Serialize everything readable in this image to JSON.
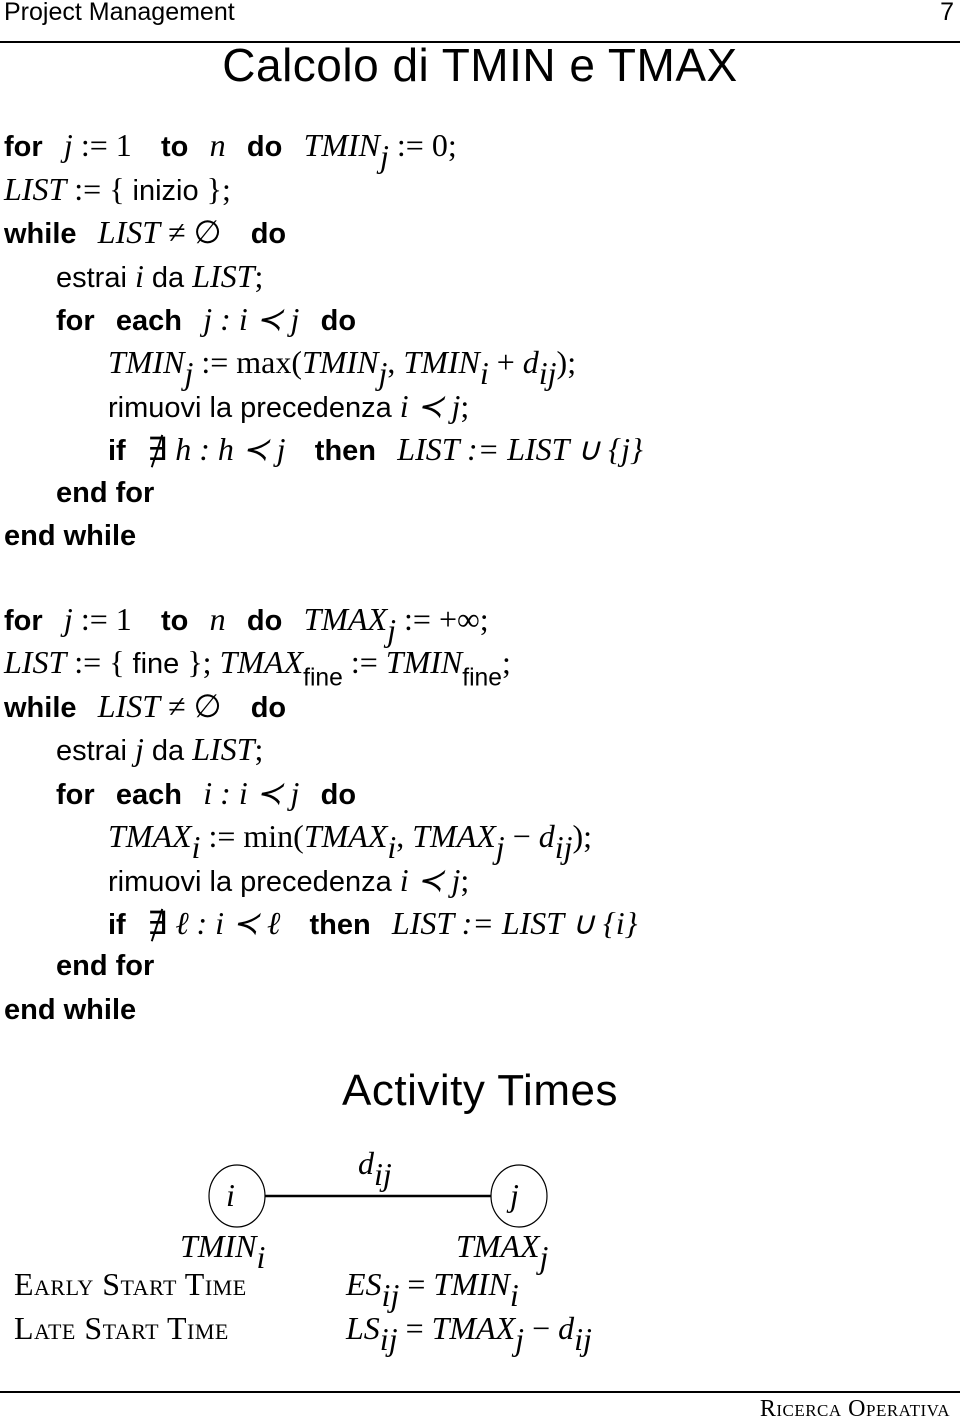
{
  "header": {
    "running_title": "Project Management",
    "page_number": "7"
  },
  "title": "Calcolo di TMIN e TMAX",
  "tmin_algorithm": {
    "l1": {
      "kw_for": "for",
      "j": "j",
      "assign1": " := 1 ",
      "kw_to": "to",
      "n": "n",
      "kw_do": "do",
      "tmin": "TMIN",
      "sub": "j",
      "assign2": " := 0;"
    },
    "l2": {
      "list": "LIST",
      "assign": " := { ",
      "inizio": "inizio",
      "close": " };"
    },
    "l3": {
      "kw_while": "while",
      "list": "LIST",
      "neq": " ≠ ∅ ",
      "kw_do": "do"
    },
    "l4": {
      "estrai": "estrai ",
      "i": "i",
      "da": " da ",
      "list": "LIST",
      "semi": ";"
    },
    "l5": {
      "kw_for": "for",
      "kw_each": "each",
      "cond": "j : i ≺ j",
      "kw_do": "do"
    },
    "l6": {
      "tmin": "TMIN",
      "sub_j": "j",
      "assign": " := ",
      "max": "max",
      "open": "(",
      "tmin2": "TMIN",
      "sub_j2": "j",
      "comma": ", ",
      "tmin3": "TMIN",
      "sub_i": "i",
      "plus": " + ",
      "d": "d",
      "sub_ij": "ij",
      "close": ");"
    },
    "l7": {
      "text": "rimuovi la precedenza ",
      "expr": "i ≺ j",
      "semi": ";"
    },
    "l8": {
      "kw_if": "if",
      "nexists": "∃",
      "cond": " h : h ≺ j ",
      "kw_then": "then",
      "expr": "LIST := LIST ∪ {j}"
    },
    "l9": {
      "kw_endfor": "end for"
    },
    "l10": {
      "kw_endwhile": "end while"
    }
  },
  "tmax_algorithm": {
    "l1": {
      "kw_for": "for",
      "j": "j",
      "assign1": " := 1 ",
      "kw_to": "to",
      "n": "n",
      "kw_do": "do",
      "tmax": "TMAX",
      "sub": "j",
      "assign2": " := +∞;"
    },
    "l2": {
      "list": "LIST",
      "assign": " := { ",
      "fine": "fine",
      "close": " }; ",
      "tmax": "TMAX",
      "sub_fine": "fine",
      "assign2": " := ",
      "tmin": "TMIN",
      "sub_fine2": "fine",
      "semi": ";"
    },
    "l3": {
      "kw_while": "while",
      "list": "LIST",
      "neq": " ≠ ∅ ",
      "kw_do": "do"
    },
    "l4": {
      "estrai": "estrai ",
      "j": "j",
      "da": " da ",
      "list": "LIST",
      "semi": ";"
    },
    "l5": {
      "kw_for": "for",
      "kw_each": "each",
      "cond": "i : i ≺ j",
      "kw_do": "do"
    },
    "l6": {
      "tmax": "TMAX",
      "sub_i": "i",
      "assign": " := ",
      "min": "min",
      "open": "(",
      "tmax2": "TMAX",
      "sub_i2": "i",
      "comma": ", ",
      "tmax3": "TMAX",
      "sub_j": "j",
      "minus": " − ",
      "d": "d",
      "sub_ij": "ij",
      "close": ");"
    },
    "l7": {
      "text": "rimuovi la precedenza ",
      "expr": "i ≺ j",
      "semi": ";"
    },
    "l8": {
      "kw_if": "if",
      "nexists": "∃",
      "cond": " ℓ : i ≺ ℓ ",
      "kw_then": "then",
      "expr": "LIST := LIST ∪ {i}"
    },
    "l9": {
      "kw_endfor": "end for"
    },
    "l10": {
      "kw_endwhile": "end while"
    }
  },
  "activity_times": {
    "title": "Activity Times",
    "diagram": {
      "node_i": "i",
      "node_j": "j",
      "edge_label": "d",
      "edge_sub": "ij",
      "label_i": "TMIN",
      "label_i_sub": "i",
      "label_j": "TMAX",
      "label_j_sub": "j"
    },
    "early": {
      "label": "Early Start Time",
      "lhs": "ES",
      "lhs_sub": "ij",
      "eq": " = ",
      "rhs": "TMIN",
      "rhs_sub": "i"
    },
    "late": {
      "label": "Late Start Time",
      "lhs": "LS",
      "lhs_sub": "ij",
      "eq": " = ",
      "rhs": "TMAX",
      "rhs_sub": "j",
      "minus": " − ",
      "d": "d",
      "d_sub": "ij"
    }
  },
  "footer": {
    "course": "Ricerca Operativa"
  }
}
